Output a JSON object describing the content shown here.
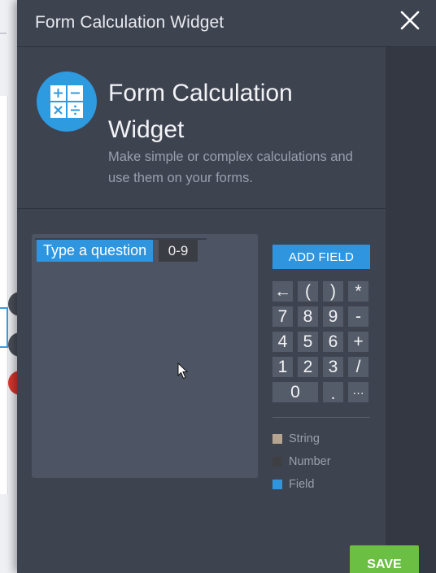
{
  "window": {
    "title": "Form Calculation Widget"
  },
  "intro": {
    "heading": "Form Calculation Widget",
    "description": "Make simple or complex calculations and use them on your forms."
  },
  "editor": {
    "field_token": "Type a question",
    "number_token": "0-9"
  },
  "keypad": {
    "add_field_label": "ADD FIELD",
    "keys": [
      {
        "label": "←",
        "name": "backspace-key"
      },
      {
        "label": "(",
        "name": "open-paren-key"
      },
      {
        "label": ")",
        "name": "close-paren-key"
      },
      {
        "label": "*",
        "name": "multiply-key"
      },
      {
        "label": "7",
        "name": "key-7"
      },
      {
        "label": "8",
        "name": "key-8"
      },
      {
        "label": "9",
        "name": "key-9"
      },
      {
        "label": "-",
        "name": "minus-key"
      },
      {
        "label": "4",
        "name": "key-4"
      },
      {
        "label": "5",
        "name": "key-5"
      },
      {
        "label": "6",
        "name": "key-6"
      },
      {
        "label": "+",
        "name": "plus-key"
      },
      {
        "label": "1",
        "name": "key-1"
      },
      {
        "label": "2",
        "name": "key-2"
      },
      {
        "label": "3",
        "name": "key-3"
      },
      {
        "label": "/",
        "name": "divide-key"
      },
      {
        "label": "0",
        "name": "key-0"
      },
      {
        "label": ".",
        "name": "decimal-key"
      },
      {
        "label": "…",
        "name": "more-key"
      }
    ]
  },
  "legend": [
    {
      "label": "String",
      "color": "#b5a48f"
    },
    {
      "label": "Number",
      "color": "#3e3f42"
    },
    {
      "label": "Field",
      "color": "#2f95df"
    }
  ],
  "footer": {
    "save_label": "SAVE"
  },
  "colors": {
    "panel": "#3e4350",
    "accent": "#2f95df",
    "save": "#6bbf43"
  },
  "icons": {
    "app": "calculator-icon",
    "close": "close-icon",
    "cursor": "mouse-pointer-icon"
  }
}
